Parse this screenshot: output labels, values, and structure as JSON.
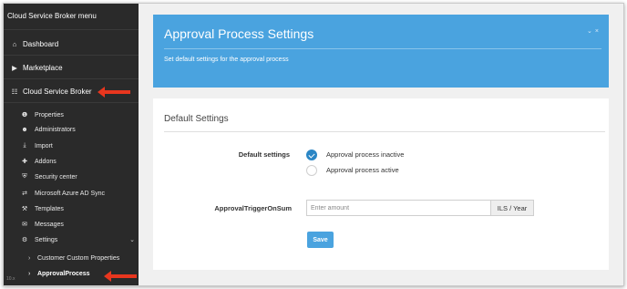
{
  "sidebar": {
    "title": "Cloud Service Broker menu",
    "items": [
      {
        "label": "Dashboard",
        "icon": "home-icon"
      },
      {
        "label": "Marketplace",
        "icon": "play-icon"
      },
      {
        "label": "Cloud Service Broker",
        "icon": "sitemap-icon"
      }
    ],
    "sub_items": [
      {
        "label": "Properties",
        "icon": "info-icon"
      },
      {
        "label": "Administrators",
        "icon": "user-icon"
      },
      {
        "label": "Import",
        "icon": "download-icon"
      },
      {
        "label": "Addons",
        "icon": "plus-icon"
      },
      {
        "label": "Security center",
        "icon": "shield-icon"
      },
      {
        "label": "Microsoft Azure AD Sync",
        "icon": "exchange-icon"
      },
      {
        "label": "Templates",
        "icon": "wrench-icon"
      },
      {
        "label": "Messages",
        "icon": "envelope-icon"
      },
      {
        "label": "Settings",
        "icon": "cogs-icon"
      }
    ],
    "settings_children": [
      {
        "label": "Customer Custom Properties"
      },
      {
        "label": "ApprovalProcess"
      }
    ],
    "version": "10.x",
    "colors": {
      "bg": "#2a2a2a",
      "annotation_arrow": "#e8361e"
    }
  },
  "hero": {
    "title": "Approval Process Settings",
    "subtitle": "Set default settings for the approval process",
    "icons": [
      "chevron-down-icon",
      "close-icon"
    ],
    "color": "#4aa3df"
  },
  "card": {
    "title": "Default Settings",
    "default_settings_label": "Default settings",
    "options": [
      {
        "label": "Approval process inactive",
        "selected": true
      },
      {
        "label": "Approval process active",
        "selected": false
      }
    ],
    "trigger_label": "ApprovalTriggerOnSum",
    "amount_placeholder": "Enter amount",
    "amount_value": "",
    "unit": "ILS / Year",
    "save_label": "Save"
  }
}
